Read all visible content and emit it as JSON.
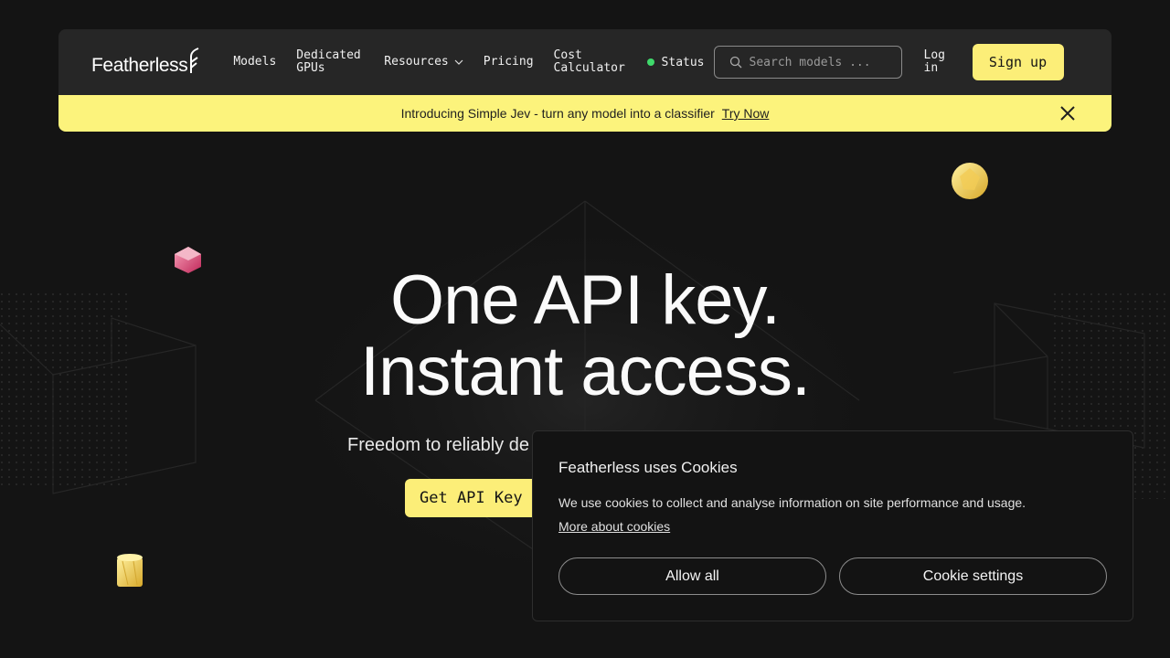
{
  "colors": {
    "accent": "#fcee78",
    "banner": "#fcf37c",
    "status": "#3fd96b",
    "background": "#141414"
  },
  "header": {
    "logo": "Featherless",
    "nav": [
      {
        "label": "Models"
      },
      {
        "label": "Dedicated\nGPUs"
      },
      {
        "label": "Resources",
        "icon": "chevron-down-icon"
      },
      {
        "label": "Pricing"
      },
      {
        "label": "Cost\nCalculator"
      }
    ],
    "status_label": "Status",
    "search_placeholder": "Search models ...",
    "login_label": "Log\nin",
    "signup_label": "Sign up"
  },
  "banner": {
    "text": "Introducing Simple Jev - turn any model into a classifier",
    "link_label": "Try Now"
  },
  "hero": {
    "title_line1": "One API key.",
    "title_line2": "Instant access.",
    "subtitle": "Freedom to reliably de",
    "cta_label": "Get API Key"
  },
  "cookie": {
    "title": "Featherless uses Cookies",
    "text": "We use cookies to collect and analyse information on site performance and usage.",
    "link_label": "More about cookies",
    "allow_label": "Allow all",
    "settings_label": "Cookie settings"
  }
}
